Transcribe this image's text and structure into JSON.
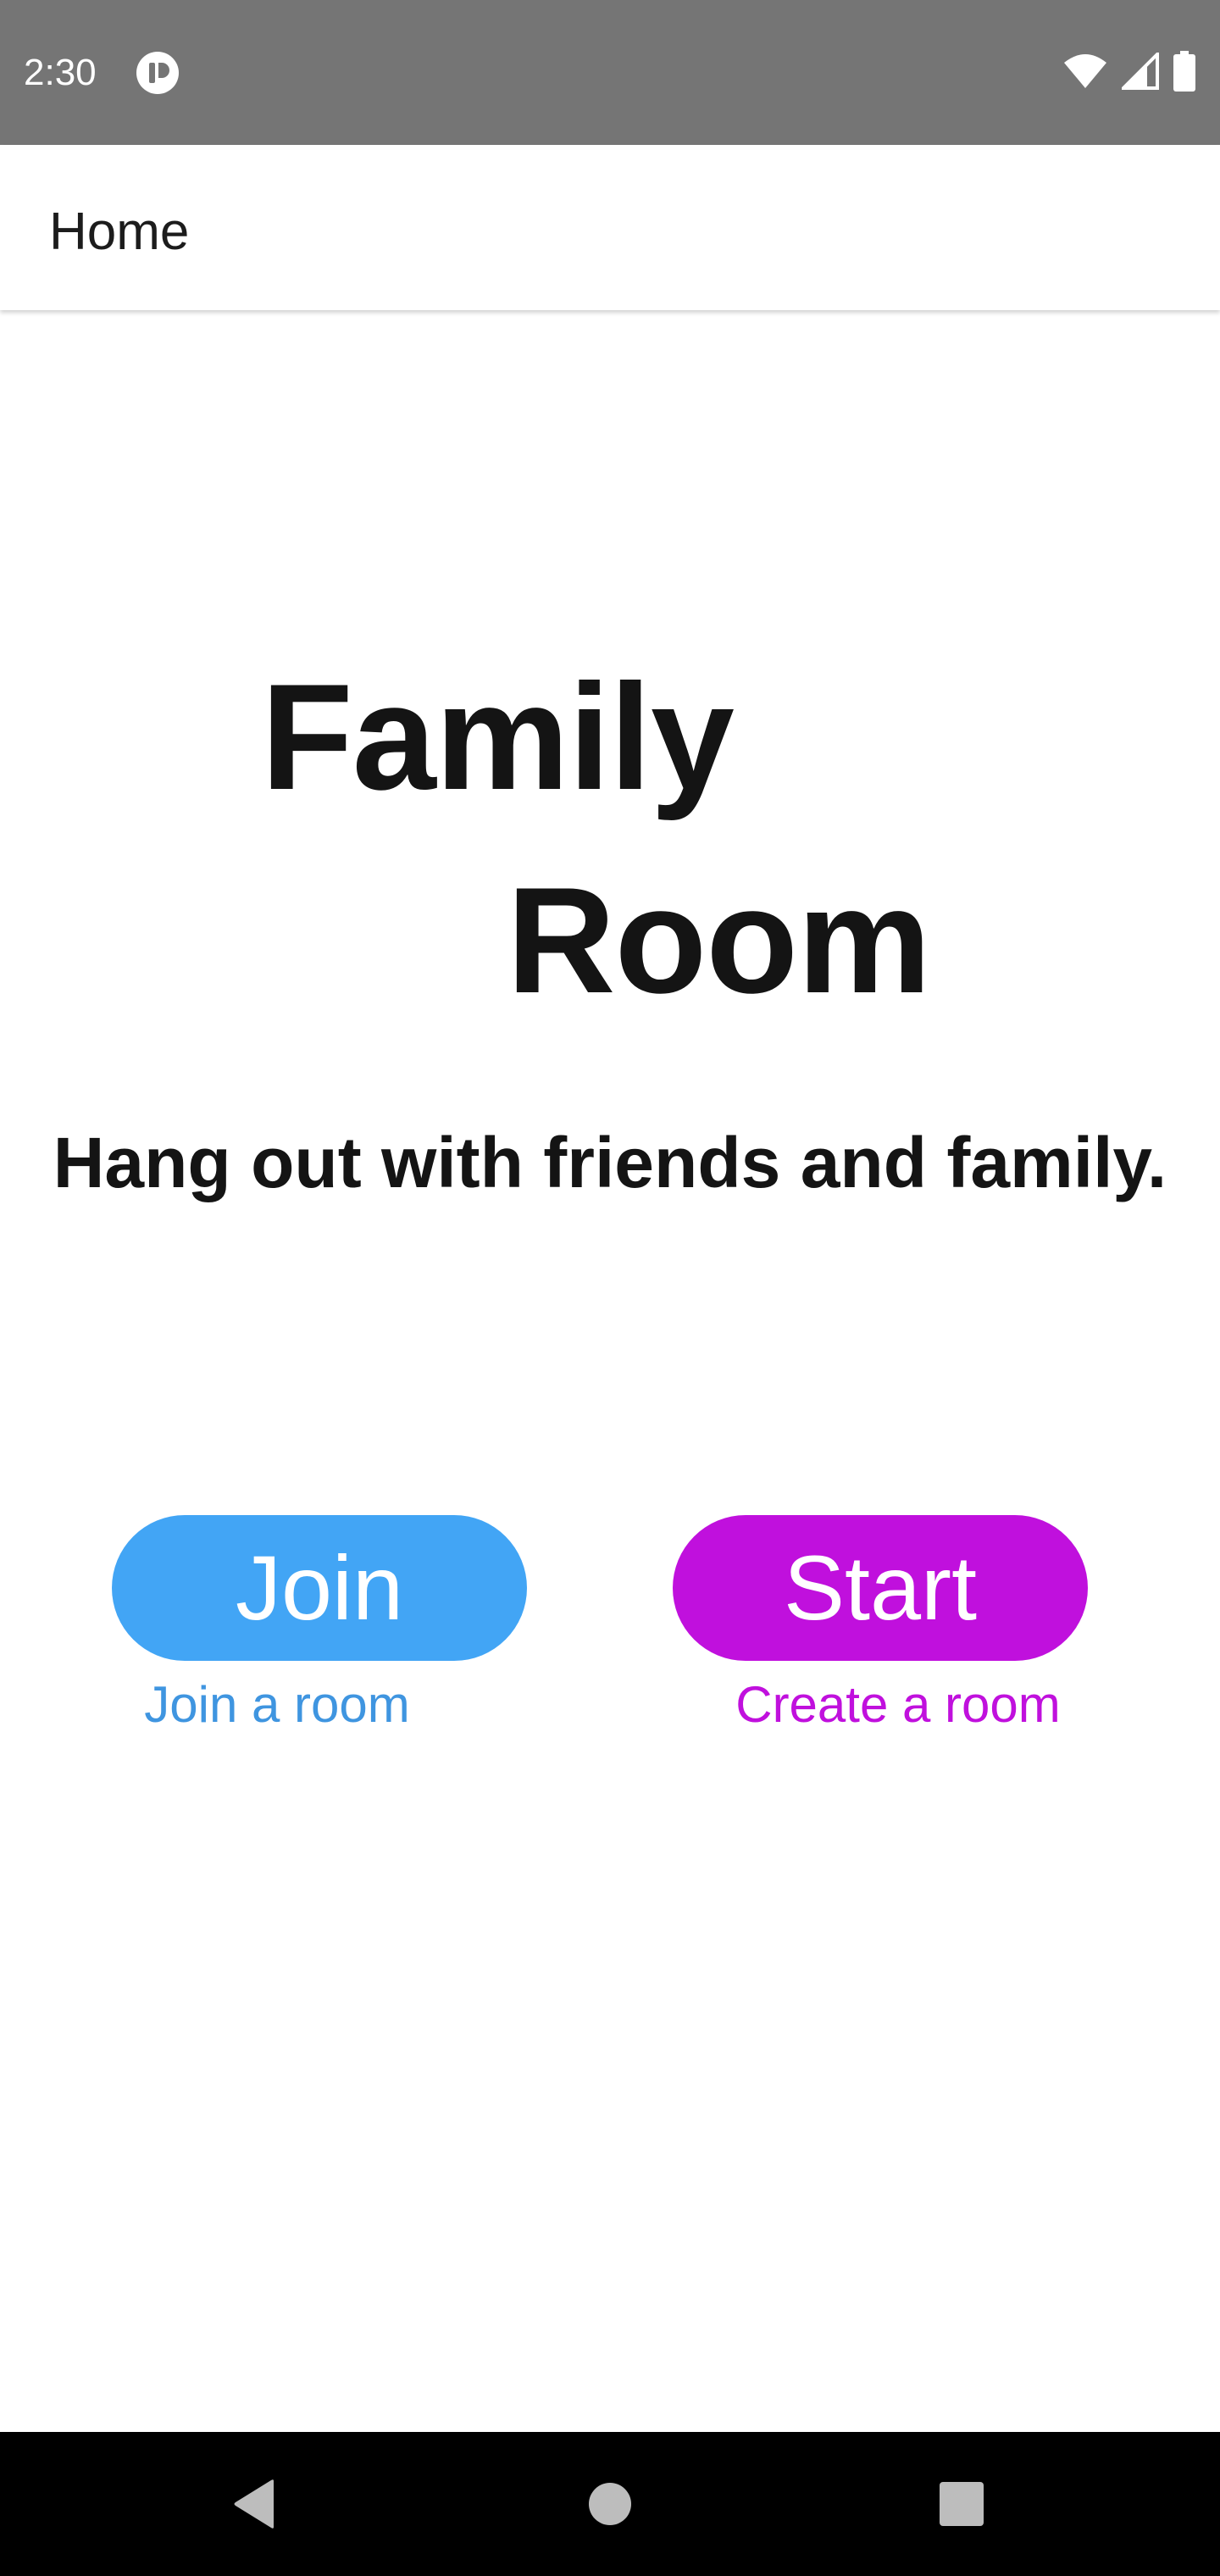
{
  "status_bar": {
    "time": "2:30",
    "app_icon": "notification-app-icon",
    "icons": [
      "wifi-icon",
      "cell-signal-icon",
      "battery-icon"
    ],
    "background": "#757575"
  },
  "app_bar": {
    "title": "Home"
  },
  "hero": {
    "line1": "Family",
    "line2": "Room",
    "tagline": "Hang out with friends and family."
  },
  "actions": {
    "join": {
      "label": "Join",
      "caption": "Join a room",
      "color": "#42a5f5"
    },
    "start": {
      "label": "Start",
      "caption": "Create a room",
      "color": "#c010dd"
    }
  },
  "nav_bar": {
    "icons": [
      "back-icon",
      "home-icon",
      "recents-icon"
    ]
  }
}
